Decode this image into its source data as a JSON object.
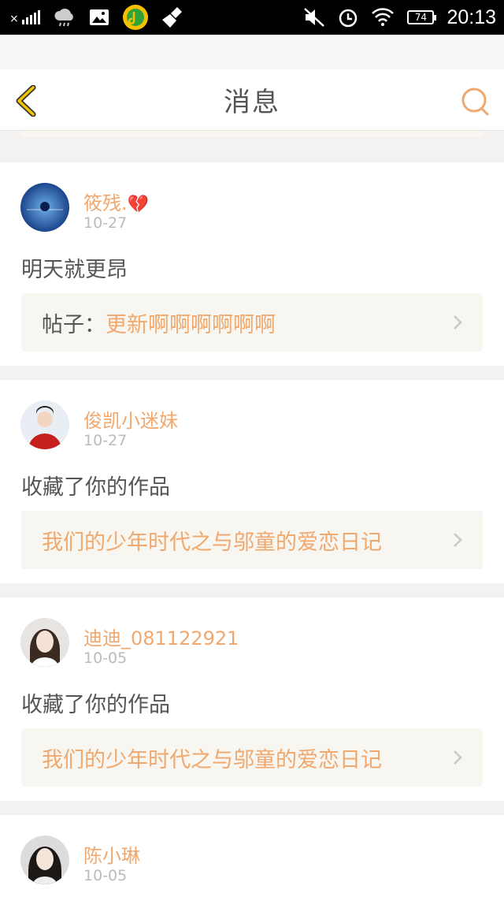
{
  "status_bar": {
    "time": "20:13",
    "battery": "74",
    "left_icons": [
      "signal-icon",
      "cloud-icon",
      "image-icon",
      "music-app-icon",
      "broom-icon"
    ],
    "right_icons": [
      "mute-icon",
      "alarm-icon",
      "wifi-icon",
      "battery-icon"
    ]
  },
  "header": {
    "title": "消息",
    "accent_color": "#f0a86e",
    "back_color": "#f2c400"
  },
  "messages": [
    {
      "name": "筱残.",
      "emoji": "💔",
      "date": "10-27",
      "text": "明天就更昂",
      "link_prefix": "帖子：",
      "link_text": "更新啊啊啊啊啊啊"
    },
    {
      "name": "俊凯小迷妹",
      "date": "10-27",
      "text": "收藏了你的作品",
      "link_text": "我们的少年时代之与邬童的爱恋日记"
    },
    {
      "name": "迪迪_081122921",
      "date": "10-05",
      "text": "收藏了你的作品",
      "link_text": "我们的少年时代之与邬童的爱恋日记"
    },
    {
      "name": "陈小琳",
      "date": "10-05"
    }
  ]
}
